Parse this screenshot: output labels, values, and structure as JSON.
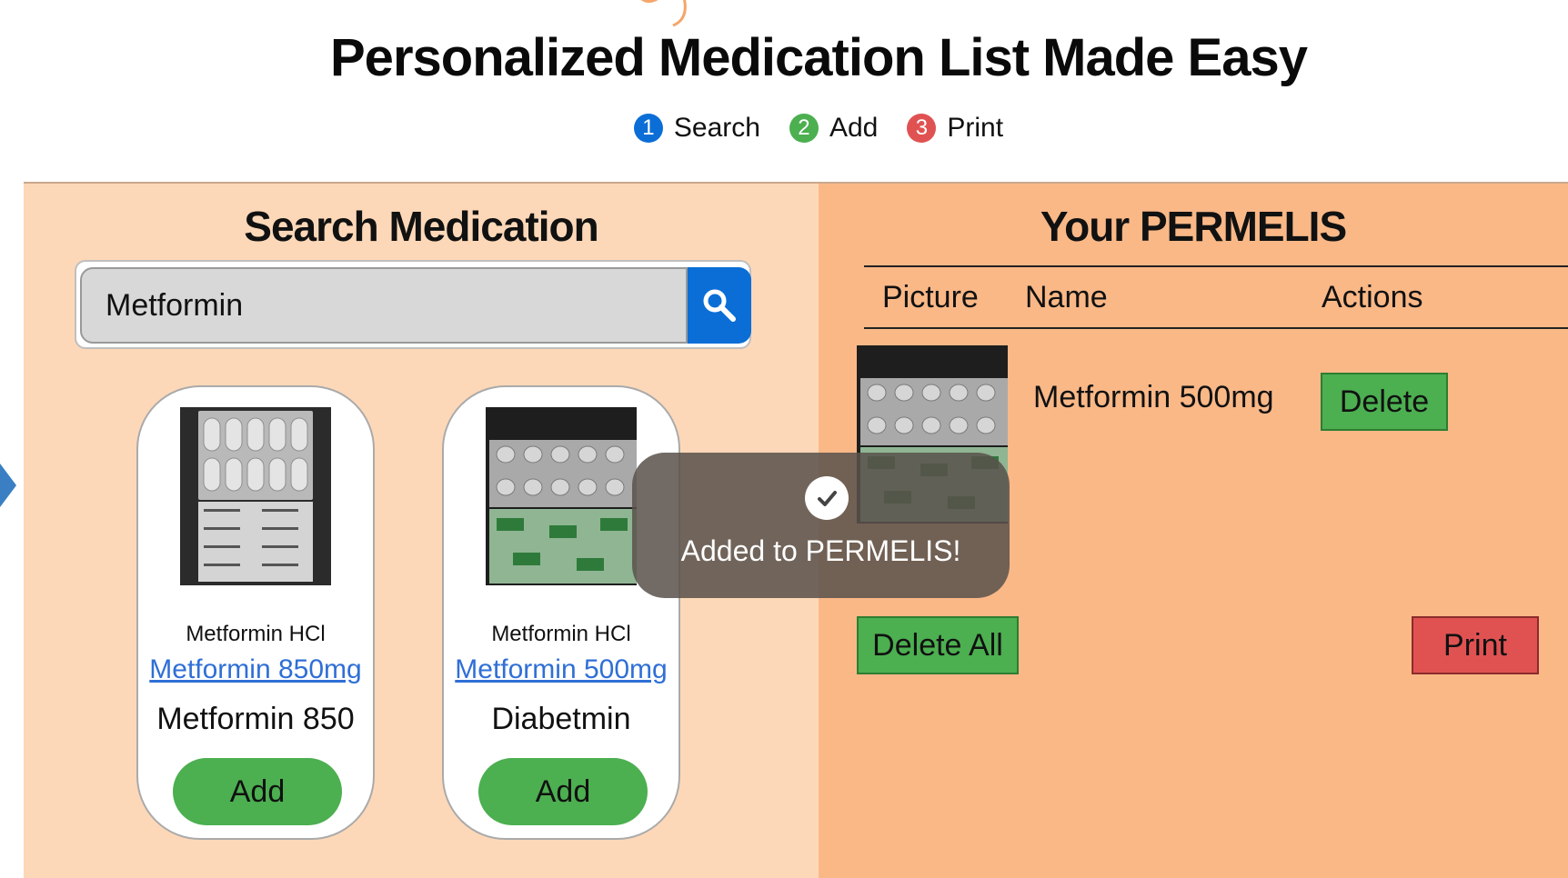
{
  "header": {
    "title": "Personalized Medication List Made Easy",
    "steps": [
      {
        "num": "1",
        "label": "Search",
        "color": "#0b6ed6"
      },
      {
        "num": "2",
        "label": "Add",
        "color": "#4caf50"
      },
      {
        "num": "3",
        "label": "Print",
        "color": "#e05252"
      }
    ]
  },
  "search_panel": {
    "title": "Search Medication",
    "search": {
      "value": "Metformin",
      "icon": "search-icon"
    },
    "results": [
      {
        "generic": "Metformin HCl",
        "link": "Metformin 850mg",
        "brand": "Metformin 850",
        "add_label": "Add"
      },
      {
        "generic": "Metformin HCl",
        "link": "Metformin 500mg",
        "brand": "Diabetmin",
        "add_label": "Add"
      }
    ]
  },
  "list_panel": {
    "title": "Your PERMELIS",
    "columns": [
      "Picture",
      "Name",
      "Actions"
    ],
    "rows": [
      {
        "name": "Metformin 500mg",
        "delete_label": "Delete"
      }
    ],
    "delete_all_label": "Delete All",
    "print_label": "Print"
  },
  "toast": {
    "message": "Added to PERMELIS!",
    "icon": "check-icon"
  },
  "colors": {
    "search_bg": "#fdd8b8",
    "list_bg": "#fab887",
    "primary": "#0b6ed6",
    "success": "#4caf50",
    "danger": "#e05252"
  }
}
